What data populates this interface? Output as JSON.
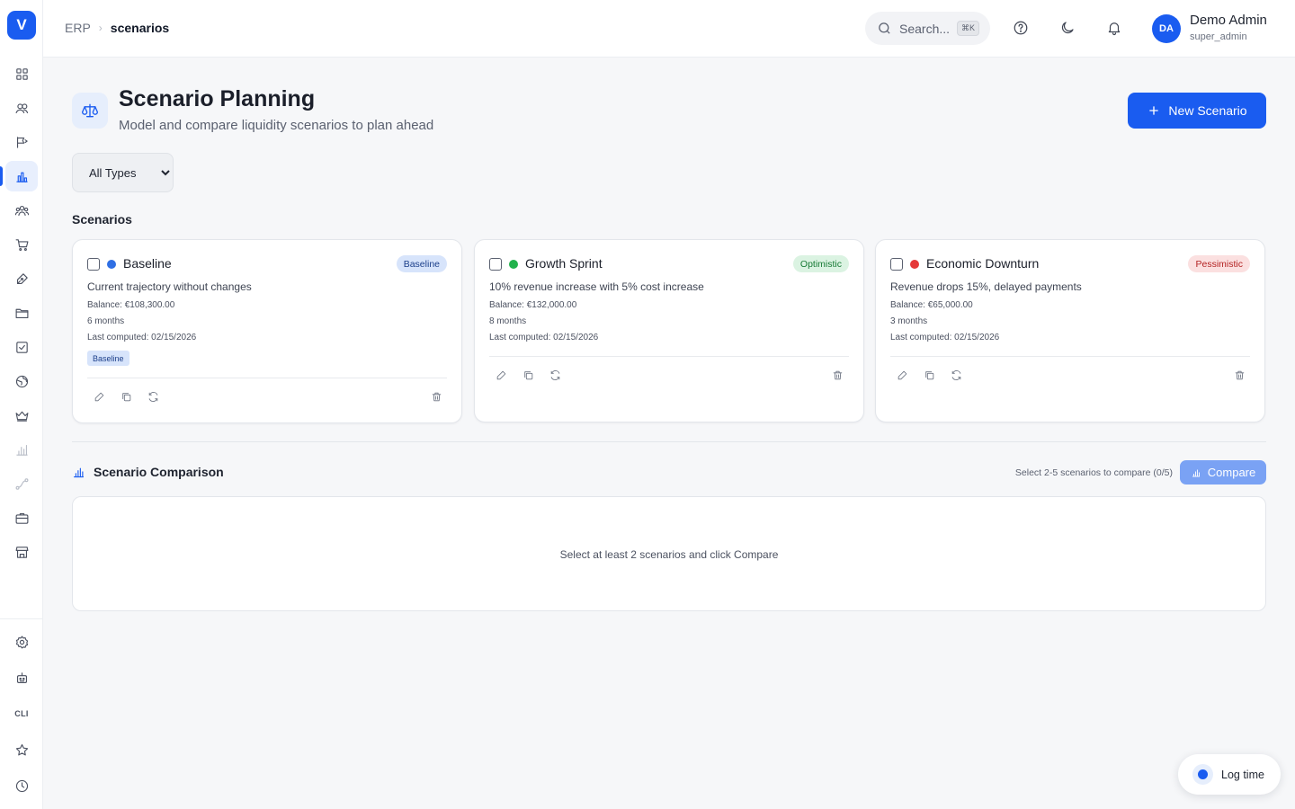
{
  "app": {
    "logo_letter": "V"
  },
  "sidebar": {
    "items": [
      {
        "icon": "dashboard-icon"
      },
      {
        "icon": "contacts-icon"
      },
      {
        "icon": "campaigns-icon"
      },
      {
        "icon": "finance-icon",
        "active": true
      },
      {
        "icon": "team-icon"
      },
      {
        "icon": "cart-icon"
      },
      {
        "icon": "pen-icon"
      },
      {
        "icon": "folder-icon"
      },
      {
        "icon": "tasks-icon"
      },
      {
        "icon": "globe-icon"
      },
      {
        "icon": "crown-icon"
      },
      {
        "icon": "analytics-icon"
      },
      {
        "icon": "workflow-icon"
      },
      {
        "icon": "briefcase-icon"
      },
      {
        "icon": "store-icon"
      }
    ],
    "bottom": {
      "settings": "settings-icon",
      "bot": "bot-icon",
      "cli_label": "CLI",
      "favorites": "star-icon",
      "history": "clock-icon"
    }
  },
  "header": {
    "breadcrumb_root": "ERP",
    "breadcrumb_current": "scenarios",
    "search_placeholder": "Search...",
    "search_shortcut": "⌘K",
    "user_initials": "DA",
    "user_name": "Demo Admin",
    "user_role": "super_admin"
  },
  "page": {
    "title": "Scenario Planning",
    "subtitle": "Model and compare liquidity scenarios to plan ahead",
    "new_button": "New Scenario",
    "filter_selected": "All Types",
    "scenarios_heading": "Scenarios"
  },
  "scenarios": [
    {
      "name": "Baseline",
      "badge": "Baseline",
      "dot_color": "#2f6fe4",
      "badge_bg": "#d7e4fb",
      "badge_fg": "#1b3e8a",
      "description": "Current trajectory without changes",
      "balance": "Balance: €108,300.00",
      "duration": "6 months",
      "last_computed": "Last computed: 02/15/2026",
      "tag": "Baseline"
    },
    {
      "name": "Growth Sprint",
      "badge": "Optimistic",
      "dot_color": "#22b24c",
      "badge_bg": "#dbf3e2",
      "badge_fg": "#177a35",
      "description": "10% revenue increase with 5% cost increase",
      "balance": "Balance: €132,000.00",
      "duration": "8 months",
      "last_computed": "Last computed: 02/15/2026"
    },
    {
      "name": "Economic Downturn",
      "badge": "Pessimistic",
      "dot_color": "#e53838",
      "badge_bg": "#fbe0e0",
      "badge_fg": "#b42323",
      "description": "Revenue drops 15%, delayed payments",
      "balance": "Balance: €65,000.00",
      "duration": "3 months",
      "last_computed": "Last computed: 02/15/2026"
    }
  ],
  "comparison": {
    "title": "Scenario Comparison",
    "hint": "Select 2-5 scenarios to compare (0/5)",
    "button": "Compare",
    "empty_text": "Select at least 2 scenarios and click Compare"
  },
  "log_time": {
    "label": "Log time"
  }
}
